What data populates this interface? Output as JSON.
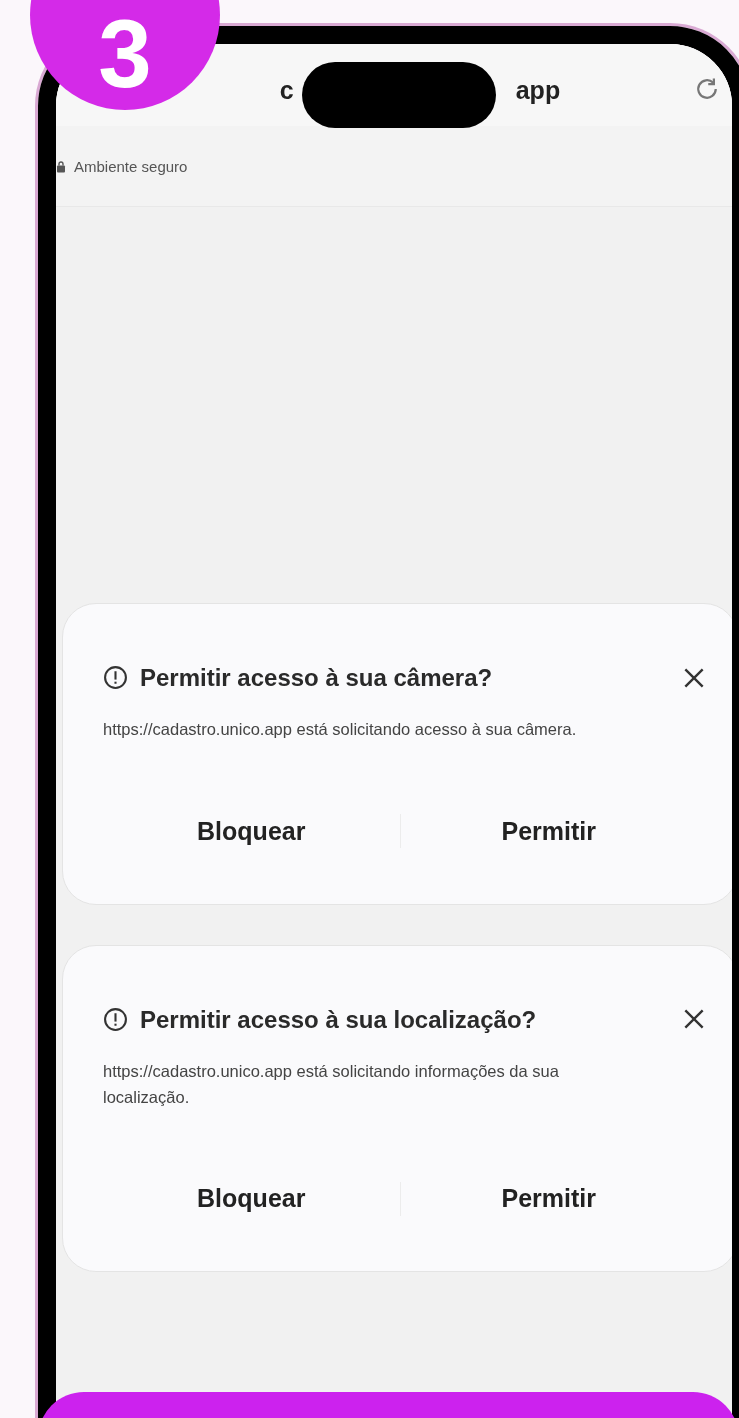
{
  "step_badge": "3",
  "browser": {
    "url_start": "c",
    "url_end": "app",
    "security_label": "Ambiente seguro"
  },
  "permission_prompts": [
    {
      "title": "Permitir acesso à sua câmera?",
      "message": "https://cadastro.unico.app está solicitando acesso à sua câmera.",
      "buttons": [
        "Bloquear",
        "Permitir"
      ]
    },
    {
      "title": "Permitir acesso à sua localização?",
      "message": "https://cadastro.unico.app está solicitando informações da sua localização.",
      "buttons": [
        "Bloquear",
        "Permitir"
      ]
    }
  ]
}
